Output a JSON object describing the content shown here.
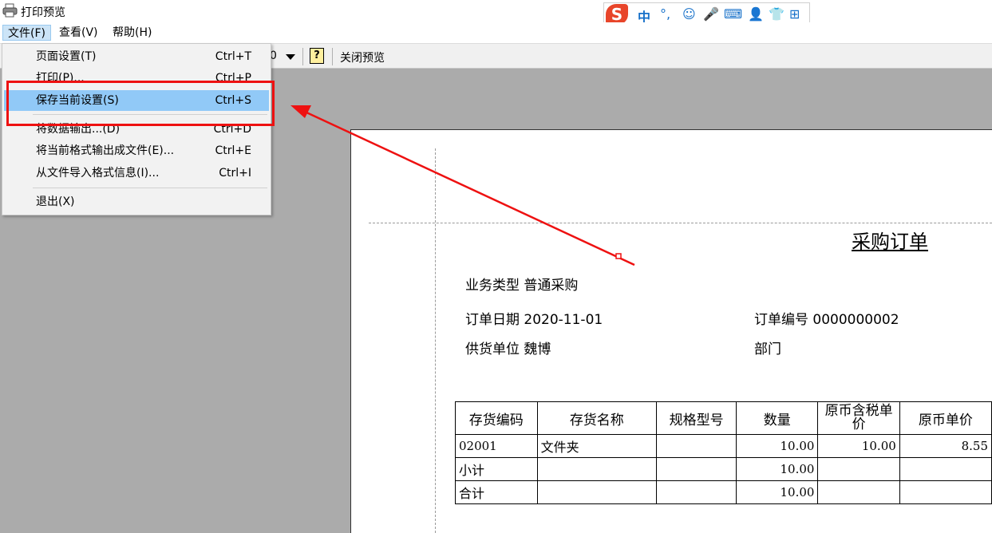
{
  "window": {
    "title": "打印预览"
  },
  "ime": {
    "items": [
      "中",
      "°,",
      "☺",
      "🎤",
      "⌨",
      "👤",
      "👕",
      "⊞"
    ]
  },
  "menubar": {
    "items": [
      "文件(F)",
      "查看(V)",
      "帮助(H)"
    ]
  },
  "toolbar": {
    "zoom_fragment": "0",
    "close_preview": "关闭预览"
  },
  "file_menu": {
    "items": [
      {
        "label": "页面设置(T)",
        "shortcut": "Ctrl+T"
      },
      {
        "label": "打印(P)...",
        "shortcut": "Ctrl+P"
      },
      {
        "label": "保存当前设置(S)",
        "shortcut": "Ctrl+S"
      },
      {
        "label": "将数据输出...(D)",
        "shortcut": "Ctrl+D"
      },
      {
        "label": "将当前格式输出成文件(E)...",
        "shortcut": "Ctrl+E"
      },
      {
        "label": "从文件导入格式信息(I)...",
        "shortcut": "Ctrl+I"
      },
      {
        "label": "退出(X)",
        "shortcut": ""
      }
    ],
    "highlighted": "保存当前设置(S)"
  },
  "document": {
    "title": "采购订单",
    "fields": {
      "business_type": "业务类型 普通采购",
      "order_date": "订单日期 2020-11-01",
      "order_number": "订单编号 0000000002",
      "supplier": "供货单位 魏博",
      "department": "部门"
    },
    "table": {
      "headers": [
        "存货编码",
        "存货名称",
        "规格型号",
        "数量",
        "原币含税单价",
        "原币单价"
      ],
      "rows": [
        [
          "02001",
          "文件夹",
          "",
          "10.00",
          "10.00",
          "8.55"
        ],
        [
          "小计",
          "",
          "",
          "10.00",
          "",
          ""
        ],
        [
          "合计",
          "",
          "",
          "10.00",
          "",
          ""
        ]
      ]
    }
  },
  "colors": {
    "annotation_red": "#ee1111",
    "menu_highlight": "#91c9f7",
    "workspace": "#ababab"
  }
}
